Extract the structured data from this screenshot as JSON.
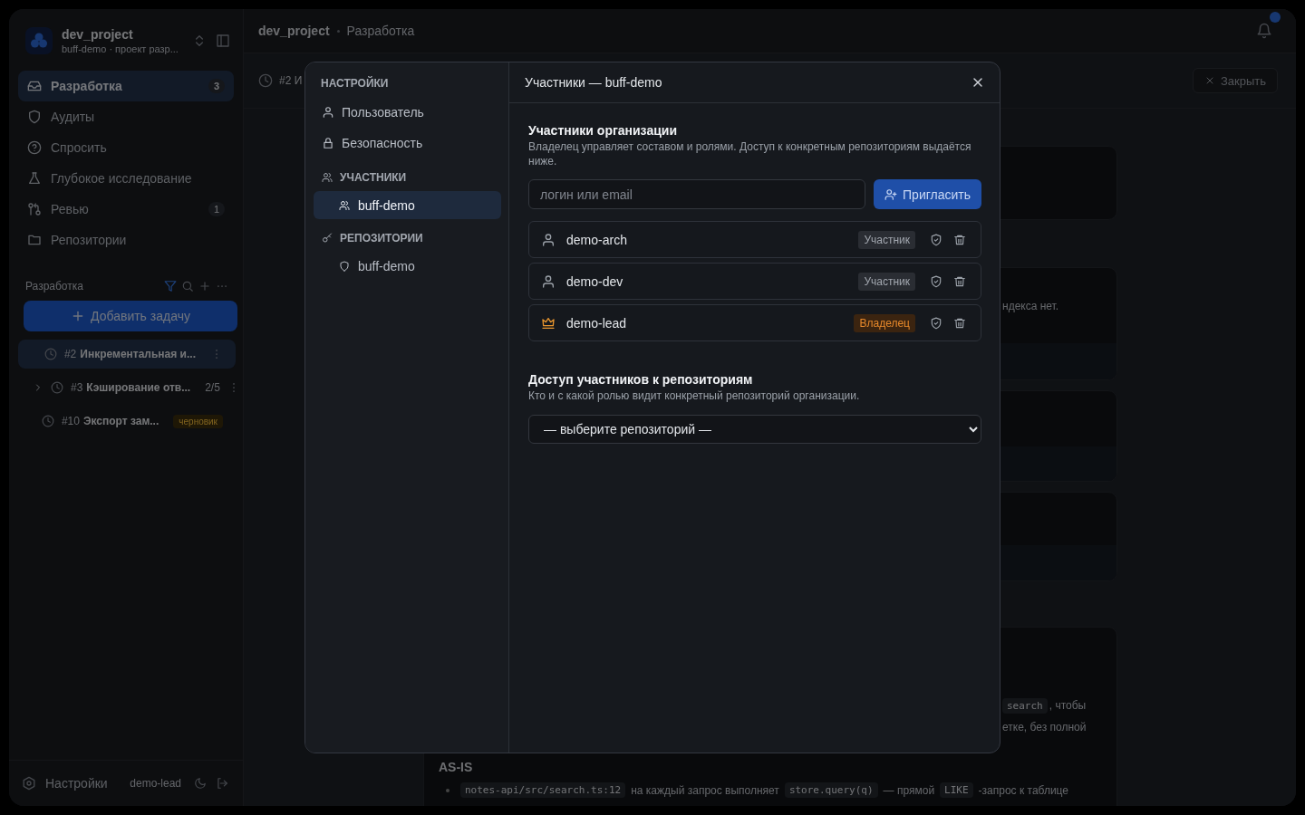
{
  "app": {
    "project": {
      "name": "dev_project",
      "subtitle": "buff-demo · проект разр..."
    },
    "nav": [
      {
        "label": "Разработка",
        "badge": "3",
        "selected": true
      },
      {
        "label": "Аудиты",
        "selected": false
      },
      {
        "label": "Спросить",
        "selected": false
      },
      {
        "label": "Глубокое исследование",
        "selected": false
      },
      {
        "label": "Ревью",
        "badge": "1",
        "selected": false
      },
      {
        "label": "Репозитории",
        "selected": false
      }
    ],
    "tasks_title": "Разработка",
    "add_task": "Добавить задачу",
    "tasks": [
      {
        "number": "#2",
        "title": "Инкрементальная и...",
        "expandable": false,
        "selected": true
      },
      {
        "number": "#3",
        "title": "Кэширование отв...",
        "progress": "2/5",
        "expandable": true,
        "selected": false
      },
      {
        "number": "#10",
        "title": "Экспорт зам...",
        "badge": "черновик",
        "expandable": false,
        "selected": false
      }
    ],
    "footer": {
      "settings": "Настройки",
      "user": "demo-lead"
    },
    "breadcrumb": [
      "dev_project",
      "Разработка"
    ],
    "task_bar": {
      "title": "#2 И",
      "close": "Закрыть"
    },
    "cards": [
      {
        "kind": "plain"
      },
      {
        "kind": "footer",
        "text": "ндекса нет."
      },
      {
        "kind": "footer"
      },
      {
        "kind": "footer"
      },
      {
        "kind": "doc",
        "lines": [
          [
            {
              "kind": "code",
              "text": "search"
            },
            {
              "kind": "text",
              "text": ", чтобы"
            }
          ],
          [
            {
              "kind": "text",
              "text": "етке, без полной"
            }
          ]
        ],
        "heading": "AS-IS",
        "bullet": [
          {
            "kind": "code",
            "text": "notes-api/src/search.ts:12"
          },
          {
            "kind": "text",
            "text": "на каждый запрос выполняет"
          },
          {
            "kind": "code",
            "text": "store.query(q)"
          },
          {
            "kind": "text",
            "text": "— прямой"
          },
          {
            "kind": "code",
            "text": "LIKE"
          },
          {
            "kind": "text",
            "text": "-запрос к таблице"
          }
        ]
      }
    ]
  },
  "modal": {
    "title": "Участники — buff-demo",
    "nav": {
      "title": "НАСТРОЙКИ",
      "items": [
        {
          "label": "Пользователь",
          "selected": false
        },
        {
          "label": "Безопасность",
          "selected": false
        }
      ],
      "groups": [
        {
          "title": "УЧАСТНИКИ",
          "items": [
            {
              "label": "buff-demo",
              "selected": true
            }
          ]
        },
        {
          "title": "РЕПОЗИТОРИИ",
          "items": [
            {
              "label": "buff-demo",
              "selected": false
            }
          ]
        }
      ]
    },
    "members_section": {
      "title": "Участники организации",
      "description": "Владелец управляет составом и ролями. Доступ к конкретным репозиториям выдаётся ниже."
    },
    "invite": {
      "placeholder": "логин или email",
      "button": "Пригласить"
    },
    "members": [
      {
        "name": "demo-arch",
        "role": "Участник",
        "kind": "member"
      },
      {
        "name": "demo-dev",
        "role": "Участник",
        "kind": "member"
      },
      {
        "name": "demo-lead",
        "role": "Владелец",
        "kind": "owner"
      }
    ],
    "access_section": {
      "title": "Доступ участников к репозиториям",
      "description": "Кто и с какой ролью видит конкретный репозиторий организации."
    },
    "repository_select": {
      "value": "— выберите репозиторий —"
    }
  }
}
